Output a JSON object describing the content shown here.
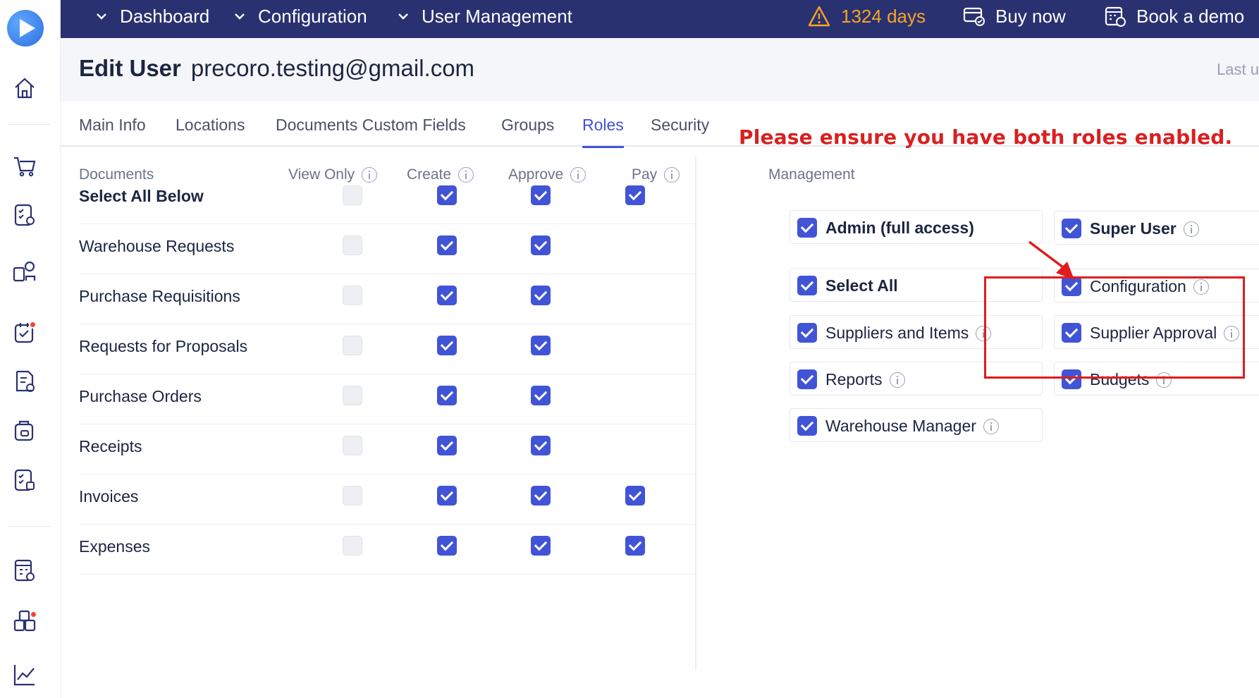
{
  "topbar": {
    "nav": [
      "Dashboard",
      "Configuration",
      "User Management"
    ],
    "trial": "1324 days",
    "buy": "Buy now",
    "demo": "Book a demo"
  },
  "header": {
    "title": "Edit User",
    "email": "precoro.testing@gmail.com",
    "last": "Last u"
  },
  "tabs": [
    "Main Info",
    "Locations",
    "Documents Custom Fields",
    "Groups",
    "Roles",
    "Security"
  ],
  "active_tab": "Roles",
  "annotation": "Please ensure you have both roles enabled.",
  "documents": {
    "header": "Documents",
    "columns": [
      "View Only",
      "Create",
      "Approve",
      "Pay"
    ],
    "rows": [
      {
        "label": "Select All Below",
        "bold": true,
        "view": false,
        "create": true,
        "approve": true,
        "pay": true
      },
      {
        "label": "Warehouse Requests",
        "bold": false,
        "view": false,
        "create": true,
        "approve": true,
        "pay": null
      },
      {
        "label": "Purchase Requisitions",
        "bold": false,
        "view": false,
        "create": true,
        "approve": true,
        "pay": null
      },
      {
        "label": "Requests for Proposals",
        "bold": false,
        "view": false,
        "create": true,
        "approve": true,
        "pay": null
      },
      {
        "label": "Purchase Orders",
        "bold": false,
        "view": false,
        "create": true,
        "approve": true,
        "pay": null
      },
      {
        "label": "Receipts",
        "bold": false,
        "view": false,
        "create": true,
        "approve": true,
        "pay": null
      },
      {
        "label": "Invoices",
        "bold": false,
        "view": false,
        "create": true,
        "approve": true,
        "pay": true
      },
      {
        "label": "Expenses",
        "bold": false,
        "view": false,
        "create": true,
        "approve": true,
        "pay": true
      }
    ]
  },
  "management": {
    "header": "Management",
    "admin": "Admin (full access)",
    "super_user": "Super User",
    "select_all": "Select All",
    "configuration": "Configuration",
    "suppliers_items": "Suppliers and Items",
    "supplier_approval": "Supplier Approval",
    "reports": "Reports",
    "budgets": "Budgets",
    "warehouse_manager": "Warehouse Manager"
  },
  "colors": {
    "accent": "#4154d6",
    "topbar": "#2a3170",
    "warning": "#f5a623",
    "annotation": "#d92020"
  }
}
